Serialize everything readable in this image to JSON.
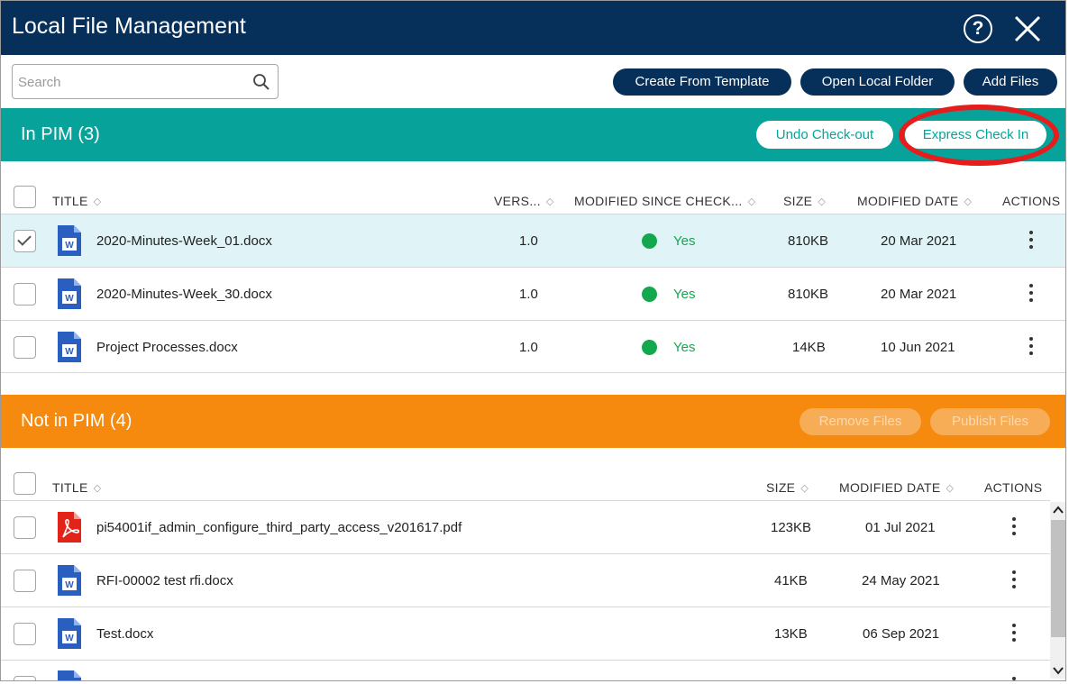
{
  "window": {
    "title": "Local File Management"
  },
  "search": {
    "placeholder": "Search",
    "value": ""
  },
  "toolbar": {
    "create_label": "Create From Template",
    "open_folder_label": "Open Local Folder",
    "add_files_label": "Add Files"
  },
  "in_pim": {
    "title": "In PIM (3)",
    "undo_label": "Undo Check-out",
    "express_label": "Express Check In",
    "headers": {
      "title": "TITLE",
      "version": "VERS...",
      "modified_since": "MODIFIED SINCE CHECK...",
      "size": "SIZE",
      "modified_date": "MODIFIED DATE",
      "actions": "ACTIONS"
    },
    "rows": [
      {
        "name": "2020-Minutes-Week_01.docx",
        "version": "1.0",
        "modified": "Yes",
        "size": "810KB",
        "date": "20 Mar 2021",
        "selected": true
      },
      {
        "name": "2020-Minutes-Week_30.docx",
        "version": "1.0",
        "modified": "Yes",
        "size": "810KB",
        "date": "20 Mar 2021",
        "selected": false
      },
      {
        "name": "Project Processes.docx",
        "version": "1.0",
        "modified": "Yes",
        "size": "14KB",
        "date": "10 Jun 2021",
        "selected": false
      }
    ]
  },
  "not_in_pim": {
    "title": "Not in PIM (4)",
    "remove_label": "Remove Files",
    "publish_label": "Publish Files",
    "headers": {
      "title": "TITLE",
      "size": "SIZE",
      "modified_date": "MODIFIED DATE",
      "actions": "ACTIONS"
    },
    "rows": [
      {
        "name": "pi54001if_admin_configure_third_party_access_v201617.pdf",
        "size": "123KB",
        "date": "01 Jul 2021",
        "icon": "pdf-icon"
      },
      {
        "name": "RFI-00002 test rfi.docx",
        "size": "41KB",
        "date": "24 May 2021",
        "icon": "word-icon"
      },
      {
        "name": "Test.docx",
        "size": "13KB",
        "date": "06 Sep 2021",
        "icon": "word-icon"
      }
    ]
  },
  "icons": {
    "help": "help-icon",
    "close": "close-icon",
    "search": "search-icon",
    "sort": "sort-icon",
    "kebab": "more-options-icon",
    "word": "word-icon",
    "pdf": "pdf-icon"
  },
  "colors": {
    "title_bar": "#062f5a",
    "in_pim_header": "#07a39b",
    "not_in_pim_header": "#f58a0f",
    "status_green": "#13a84e",
    "highlight_ellipse": "#e51d1d",
    "selected_row": "#e0f4f7"
  }
}
